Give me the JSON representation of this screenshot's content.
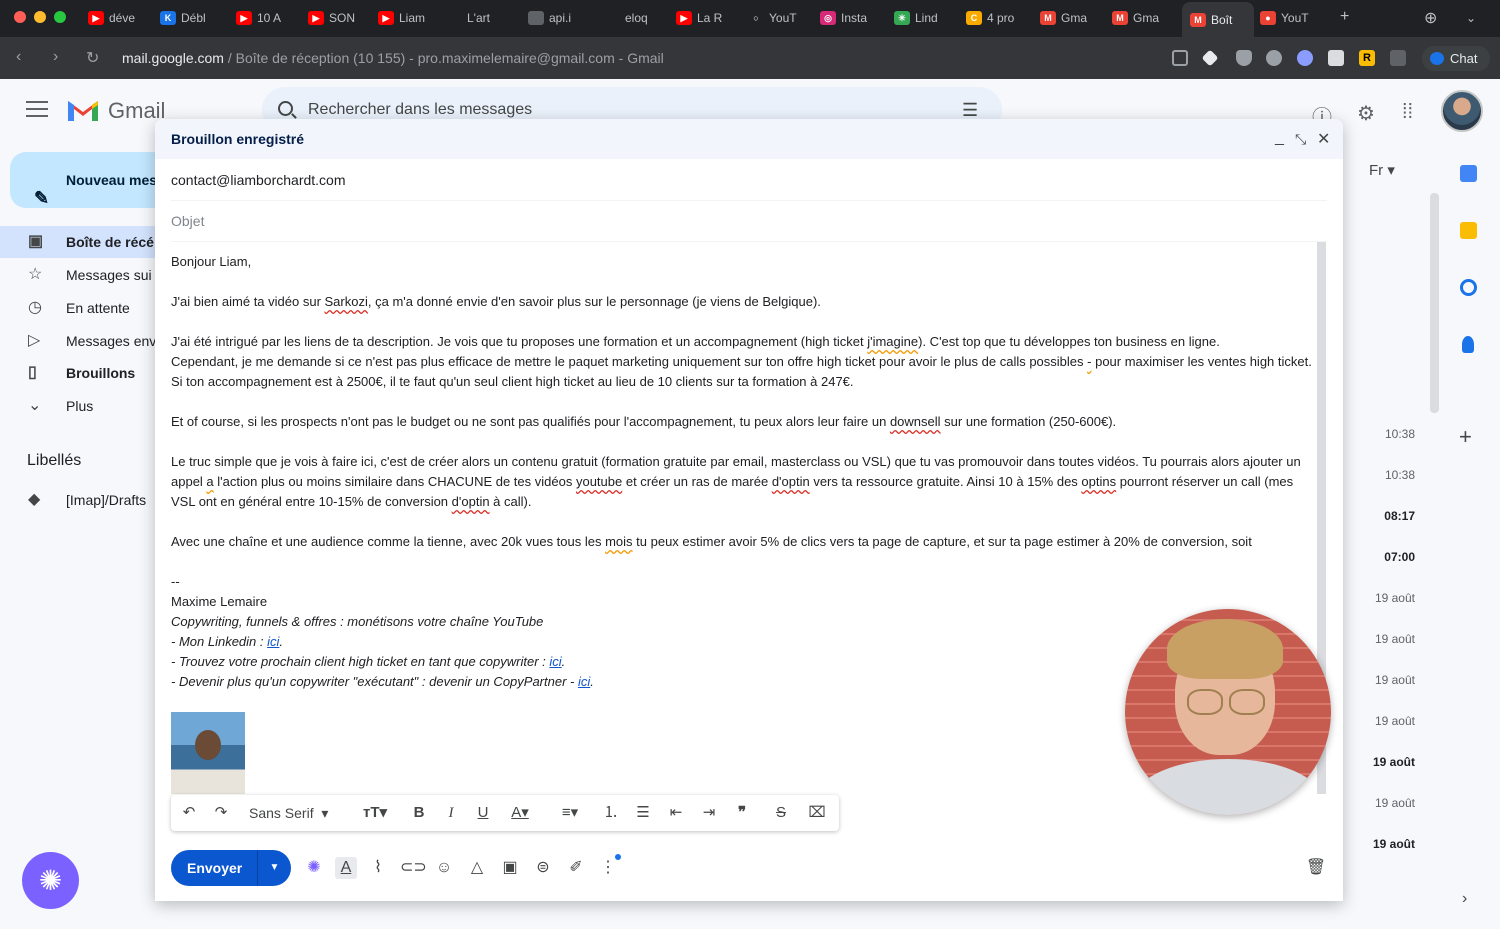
{
  "browser": {
    "tabs": [
      {
        "label": "déve",
        "color": "#ff0000",
        "glyph": "▶"
      },
      {
        "label": "Débl",
        "color": "#1a73e8",
        "glyph": "K"
      },
      {
        "label": "10 A",
        "color": "#ff0000",
        "glyph": "▶"
      },
      {
        "label": "SON",
        "color": "#ff0000",
        "glyph": "▶"
      },
      {
        "label": "Liam",
        "color": "#ff0000",
        "glyph": "▶"
      },
      {
        "label": "L'art",
        "color": "#202124",
        "glyph": ""
      },
      {
        "label": "api.i",
        "color": "#5f6368",
        "glyph": ""
      },
      {
        "label": "eloq",
        "color": "#202124",
        "glyph": ""
      },
      {
        "label": "La R",
        "color": "#ff0000",
        "glyph": "▶"
      },
      {
        "label": "YouT",
        "color": "#202124",
        "glyph": "○"
      },
      {
        "label": "Insta",
        "color": "#d62976",
        "glyph": "◎"
      },
      {
        "label": "Lind",
        "color": "#34a853",
        "glyph": "✳"
      },
      {
        "label": "4 pro",
        "color": "#f9ab00",
        "glyph": "C"
      },
      {
        "label": "Gma",
        "color": "#ea4335",
        "glyph": "M"
      },
      {
        "label": "Gma",
        "color": "#ea4335",
        "glyph": "M"
      },
      {
        "label": "Boît",
        "color": "#ea4335",
        "glyph": "M"
      },
      {
        "label": "YouT",
        "color": "#ea4335",
        "glyph": "●"
      }
    ],
    "url_host": "mail.google.com",
    "url_rest": " / Boîte de réception (10 155) - pro.maximelemaire@gmail.com - Gmail",
    "chat_label": "Chat"
  },
  "gmail": {
    "brand": "Gmail",
    "search_placeholder": "Rechercher dans les messages",
    "compose_label": "Nouveau mes",
    "nav": [
      {
        "label": "Boîte de récé",
        "icon": "inbox-icon",
        "glyph": "▣"
      },
      {
        "label": "Messages sui",
        "icon": "star-icon",
        "glyph": "☆"
      },
      {
        "label": "En attente",
        "icon": "clock-icon",
        "glyph": "◷"
      },
      {
        "label": "Messages env",
        "icon": "send-icon",
        "glyph": "▷"
      },
      {
        "label": "Brouillons",
        "icon": "draft-icon",
        "glyph": "▯"
      },
      {
        "label": "Plus",
        "icon": "chevron-down-icon",
        "glyph": "⌄"
      }
    ],
    "labels_title": "Libellés",
    "label_items": [
      {
        "label": "[Imap]/Drafts",
        "icon": "label-icon"
      }
    ],
    "lang_label": "Fr",
    "times": [
      {
        "label": "10:38",
        "bold": false
      },
      {
        "label": "10:38",
        "bold": false
      },
      {
        "label": "08:17",
        "bold": true
      },
      {
        "label": "07:00",
        "bold": true
      },
      {
        "label": "19 août",
        "bold": false
      },
      {
        "label": "19 août",
        "bold": false
      },
      {
        "label": "19 août",
        "bold": false
      },
      {
        "label": "19 août",
        "bold": false
      },
      {
        "label": "19 août",
        "bold": true
      },
      {
        "label": "19 août",
        "bold": false
      },
      {
        "label": "19 août",
        "bold": true
      }
    ]
  },
  "compose": {
    "title": "Brouillon enregistré",
    "to": "contact@liamborchardt.com",
    "subject_placeholder": "Objet",
    "greeting": "Bonjour Liam,",
    "p1a": "J'ai bien aimé ta vidéo sur ",
    "p1b": "Sarkozi",
    "p1c": ", ça m'a donné envie d'en savoir plus sur le personnage (je viens de Belgique).",
    "p2a": "J'ai été intrigué par les liens de ta description. Je vois que tu proposes une formation et un accompagnement (high ticket ",
    "p2b": "j'imagine",
    "p2c": "). C'est top que tu développes ton business en ligne.",
    "p3a": "Cependant, je me demande si ce n'est pas plus efficace de mettre le paquet marketing uniquement sur ton offre high ticket pour avoir le plus de calls possibles ",
    "p3b": "-",
    "p3c": " pour maximiser les ventes high ticket.",
    "p4": "Si ton accompagnement est à 2500€, il te faut qu'un seul client high ticket au lieu de 10 clients sur ta formation à 247€.",
    "p5a": "Et of course, si les prospects n'ont pas le budget ou ne sont pas qualifiés pour l'accompagnement, tu peux alors leur faire un ",
    "p5b": "downsell",
    "p5c": " sur une formation (250-600€).",
    "p6a": "Le truc simple que je vois à faire ici, c'est de créer alors un contenu gratuit (formation gratuite par email, masterclass ou VSL) que tu vas promouvoir dans toutes vidéos. Tu pourrais alors ajouter un appel ",
    "p6b": "a",
    "p6c": " l'action plus ou moins similaire dans CHACUNE de tes vidéos ",
    "p6d": "youtube",
    "p6e": " et créer un ras de marée ",
    "p6f": "d'optin",
    "p6g": " vers ta ressource gratuite. Ainsi 10 à 15% des ",
    "p6h": "optins",
    "p6i": " pourront réserver un call (mes VSL ont en général entre 10-15% de conversion ",
    "p6j": "d'optin",
    "p6k": " à call).",
    "p7a": "Avec une chaîne et une audience comme la tienne, avec 20k vues tous les ",
    "p7b": "mois",
    "p7c": " tu peux estimer avoir 5% de clics vers ta page de capture, et sur ta page estimer à 20% de conversion, soit",
    "sig_sep": "--",
    "sig_name": "Maxime Lemaire",
    "sig_tagline": "Copywriting, funnels & offres : monétisons votre chaîne YouTube",
    "sig_l1": "- Mon Linkedin : ",
    "sig_l2": "- Trouvez votre prochain client high ticket en tant que copywriter : ",
    "sig_l3": "- Devenir plus qu'un copywriter \"exécutant\" : devenir un CopyPartner - ",
    "link_text": "ici",
    "font_label": "Sans Serif",
    "send_label": "Envoyer"
  }
}
